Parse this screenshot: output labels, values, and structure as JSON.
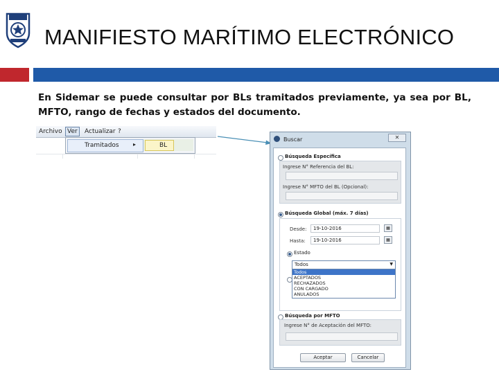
{
  "slide": {
    "title": "MANIFIESTO MARÍTIMO ELECTRÓNICO",
    "description_line1": "En Sidemar se puede consultar por BLs tramitados previamente, ya sea por BL,",
    "description_line2": "MFTO, rango de fechas y estados del documento.",
    "colors": {
      "accent_red": "#c0272d",
      "accent_blue": "#1f5aa8",
      "logo_blue": "#1f3f7a"
    },
    "logo_icon": "star-badge-icon"
  },
  "menu": {
    "bar_items": [
      "Archivo",
      "Ver",
      "Actualizar",
      "?"
    ],
    "submenu_item": "Tramitados",
    "submenu_arrow": "▸",
    "subsubmenu_item": "BL"
  },
  "dialog": {
    "title": "Buscar",
    "close": "✕",
    "specific": {
      "title": "Búsqueda Específica",
      "bl_label": "Ingrese N° Referencia del BL:",
      "mfto_label": "Ingrese N° MFTO del BL (Opcional):"
    },
    "global": {
      "title": "Búsqueda Global (máx. 7 días)",
      "from_label": "Desde:",
      "from_value": "19-10-2016",
      "to_label": "Hasta:",
      "to_value": "19-10-2016",
      "state_title": "Estado",
      "state_selected": "Todos",
      "state_options": [
        "Todos",
        "ACEPTADOS",
        "RECHAZADOS",
        "CON CARGADO",
        "ANULADOS"
      ]
    },
    "mfto": {
      "title": "Búsqueda por MFTO",
      "label": "Ingrese N° de Aceptación del MFTO:"
    },
    "accept_button": "Aceptar",
    "cancel_button": "Cancelar"
  }
}
